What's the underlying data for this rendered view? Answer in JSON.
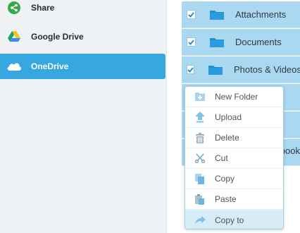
{
  "sidebar": {
    "items": [
      {
        "label": "Share",
        "icon": "share-icon",
        "selected": false
      },
      {
        "label": "Google Drive",
        "icon": "google-drive-icon",
        "selected": false
      },
      {
        "label": "OneDrive",
        "icon": "onedrive-cloud-icon",
        "selected": true
      }
    ]
  },
  "files": {
    "rows": [
      {
        "label": "Attachments",
        "checked": true
      },
      {
        "label": "Documents",
        "checked": true
      },
      {
        "label": "Photos & Videos",
        "checked": true
      },
      {
        "label": "",
        "checked": false
      },
      {
        "label": "",
        "checked": false
      },
      {
        "label": "",
        "checked": false
      }
    ],
    "partial_label": "ebook"
  },
  "context_menu": {
    "items": [
      {
        "label": "New Folder",
        "icon": "new-folder-icon"
      },
      {
        "label": "Upload",
        "icon": "upload-icon"
      },
      {
        "label": "Delete",
        "icon": "trash-icon"
      },
      {
        "label": "Cut",
        "icon": "scissors-icon"
      },
      {
        "label": "Copy",
        "icon": "copy-icon"
      },
      {
        "label": "Paste",
        "icon": "paste-icon"
      },
      {
        "label": "Copy to",
        "icon": "copy-to-icon",
        "highlighted": true
      }
    ]
  },
  "colors": {
    "accent": "#37a8df",
    "selected_row": "#a9d8f0",
    "menu_highlight": "#d8ecf8",
    "icon_blue": "#7fc0e6",
    "folder_blue": "#1f8fd0"
  }
}
